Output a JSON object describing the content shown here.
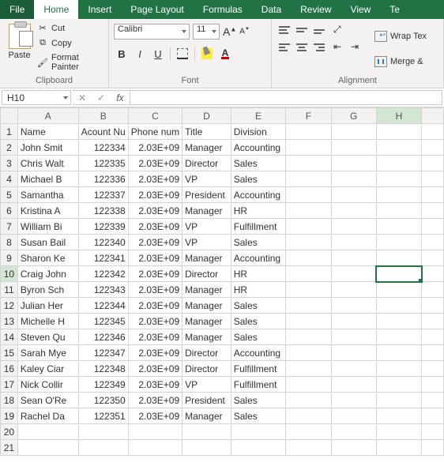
{
  "tabs": [
    "File",
    "Home",
    "Insert",
    "Page Layout",
    "Formulas",
    "Data",
    "Review",
    "View",
    "Te"
  ],
  "active_tab": "Home",
  "clipboard": {
    "paste": "Paste",
    "cut": "Cut",
    "copy": "Copy",
    "format_painter": "Format Painter",
    "group_label": "Clipboard"
  },
  "font": {
    "name": "Calibri",
    "size": "11",
    "group_label": "Font"
  },
  "alignment": {
    "wrap": "Wrap Tex",
    "merge": "Merge &",
    "group_label": "Alignment"
  },
  "namebox": "H10",
  "formula": "",
  "columns": [
    "A",
    "B",
    "C",
    "D",
    "E",
    "F",
    "G",
    "H"
  ],
  "header_row": [
    "Name",
    "Acount Nu",
    "Phone num",
    "Title",
    "Division"
  ],
  "rows": [
    {
      "n": 1
    },
    {
      "n": 2,
      "a": "John Smit",
      "b": "122334",
      "c": "2.03E+09",
      "d": "Manager",
      "e": "Accounting"
    },
    {
      "n": 3,
      "a": "Chris Walt",
      "b": "122335",
      "c": "2.03E+09",
      "d": "Director",
      "e": "Sales"
    },
    {
      "n": 4,
      "a": "Michael B",
      "b": "122336",
      "c": "2.03E+09",
      "d": "VP",
      "e": "Sales"
    },
    {
      "n": 5,
      "a": "Samantha",
      "b": "122337",
      "c": "2.03E+09",
      "d": "President",
      "e": "Accounting"
    },
    {
      "n": 6,
      "a": "Kristina A",
      "b": "122338",
      "c": "2.03E+09",
      "d": "Manager",
      "e": "HR"
    },
    {
      "n": 7,
      "a": "William Bi",
      "b": "122339",
      "c": "2.03E+09",
      "d": "VP",
      "e": "Fulfillment"
    },
    {
      "n": 8,
      "a": "Susan Bail",
      "b": "122340",
      "c": "2.03E+09",
      "d": "VP",
      "e": "Sales"
    },
    {
      "n": 9,
      "a": "Sharon Ke",
      "b": "122341",
      "c": "2.03E+09",
      "d": "Manager",
      "e": "Accounting"
    },
    {
      "n": 10,
      "a": "Craig John",
      "b": "122342",
      "c": "2.03E+09",
      "d": "Director",
      "e": "HR"
    },
    {
      "n": 11,
      "a": "Byron Sch",
      "b": "122343",
      "c": "2.03E+09",
      "d": "Manager",
      "e": "HR"
    },
    {
      "n": 12,
      "a": "Julian Her",
      "b": "122344",
      "c": "2.03E+09",
      "d": "Manager",
      "e": "Sales"
    },
    {
      "n": 13,
      "a": "Michelle H",
      "b": "122345",
      "c": "2.03E+09",
      "d": "Manager",
      "e": "Sales"
    },
    {
      "n": 14,
      "a": "Steven Qu",
      "b": "122346",
      "c": "2.03E+09",
      "d": "Manager",
      "e": "Sales"
    },
    {
      "n": 15,
      "a": "Sarah Mye",
      "b": "122347",
      "c": "2.03E+09",
      "d": "Director",
      "e": "Accounting"
    },
    {
      "n": 16,
      "a": "Kaley Ciar",
      "b": "122348",
      "c": "2.03E+09",
      "d": "Director",
      "e": "Fulfillment"
    },
    {
      "n": 17,
      "a": "Nick Collir",
      "b": "122349",
      "c": "2.03E+09",
      "d": "VP",
      "e": "Fulfillment"
    },
    {
      "n": 18,
      "a": "Sean O'Re",
      "b": "122350",
      "c": "2.03E+09",
      "d": "President",
      "e": "Sales"
    },
    {
      "n": 19,
      "a": "Rachel Da",
      "b": "122351",
      "c": "2.03E+09",
      "d": "Manager",
      "e": "Sales"
    },
    {
      "n": 20
    },
    {
      "n": 21
    }
  ],
  "selected_cell": {
    "row": 10,
    "col": "H"
  }
}
